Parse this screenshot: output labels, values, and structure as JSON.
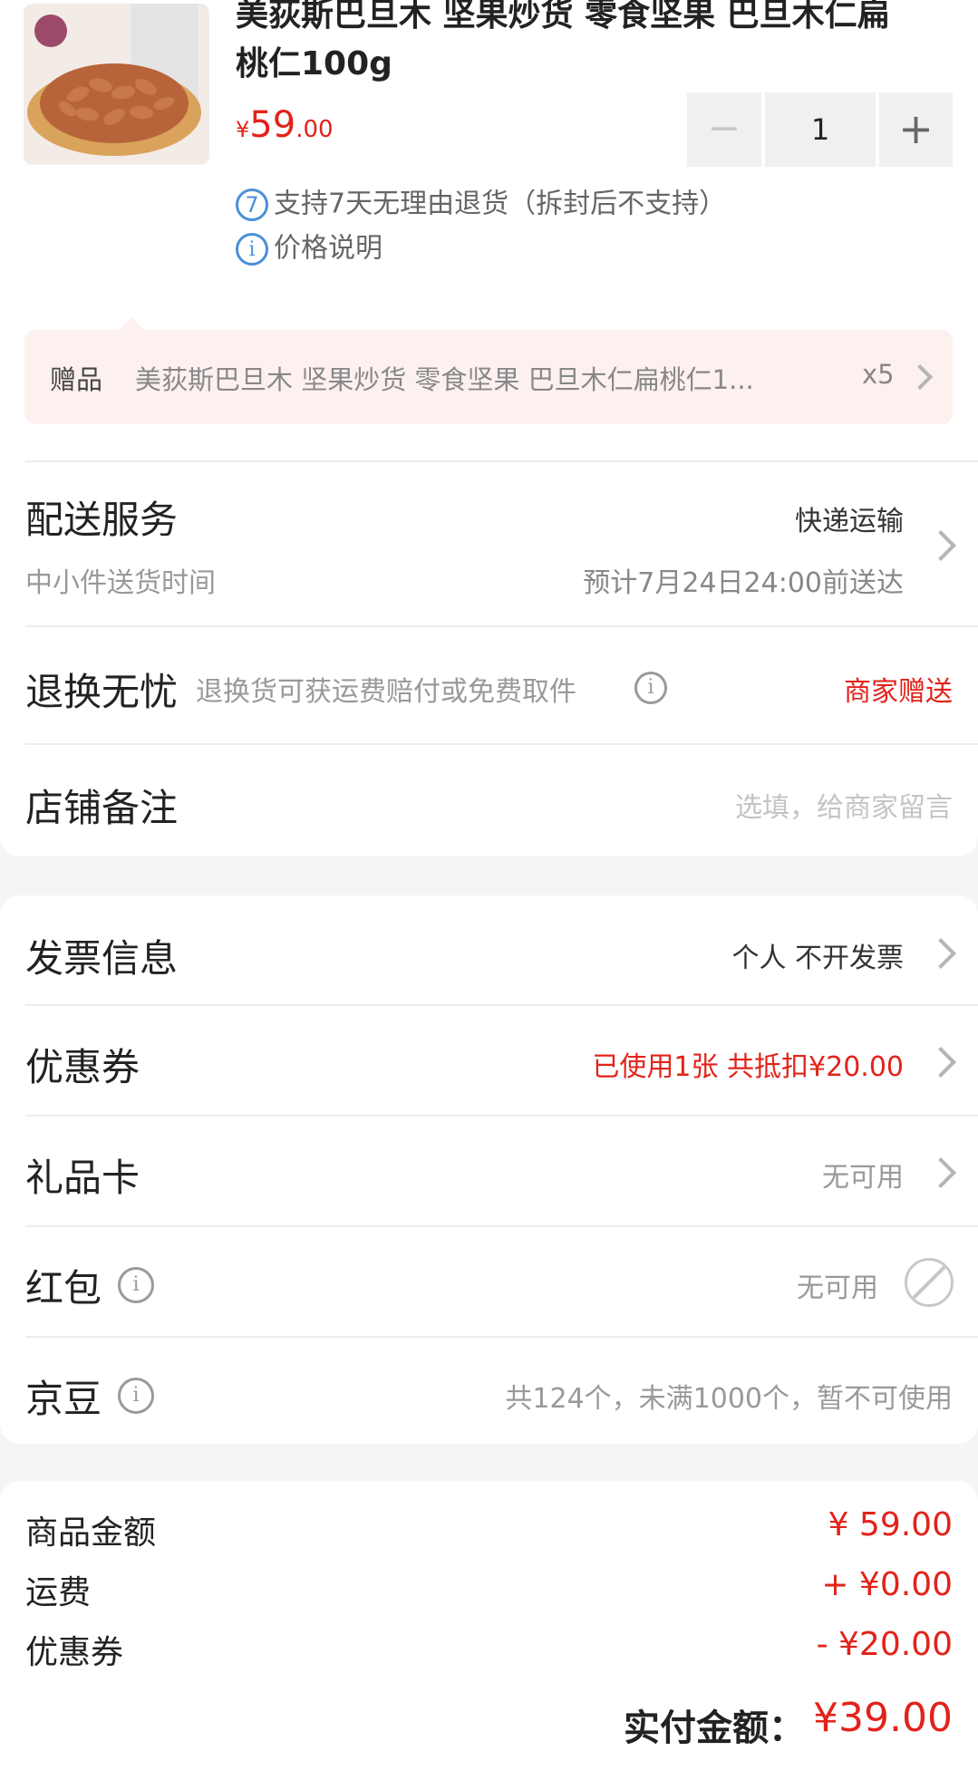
{
  "product": {
    "title_line1": "美荻斯巴旦木 坚果炒货 零食坚果 巴旦木仁扁",
    "title_line2": "桃仁100g",
    "currency": "¥",
    "price_int": "59",
    "price_dec": ".00",
    "qty": "1",
    "minus": "−",
    "plus": "+",
    "badge_7": "7",
    "return_policy": "支持7天无理由退货（拆封后不支持）",
    "price_note": "价格说明",
    "info_glyph": "i"
  },
  "gift": {
    "label": "赠品",
    "name": "美荻斯巴旦木 坚果炒货 零食坚果 巴旦木仁扁桃仁1...",
    "count": "x5"
  },
  "delivery": {
    "title": "配送服务",
    "method": "快递运输",
    "subtitle": "中小件送货时间",
    "eta": "预计7月24日24:00前送达"
  },
  "return_service": {
    "title": "退换无忧",
    "desc": "退换货可获运费赔付或免费取件",
    "status": "商家赠送"
  },
  "note": {
    "title": "店铺备注",
    "placeholder": "选填，给商家留言"
  },
  "invoice": {
    "title": "发票信息",
    "value": "个人 不开发票"
  },
  "coupon": {
    "title": "优惠券",
    "value": "已使用1张 共抵扣¥20.00"
  },
  "giftcard": {
    "title": "礼品卡",
    "value": "无可用"
  },
  "redpacket": {
    "title": "红包",
    "value": "无可用"
  },
  "jingdou": {
    "title": "京豆",
    "value": "共124个，未满1000个，暂不可使用"
  },
  "summary": {
    "goods_label": "商品金额",
    "goods_value": "¥ 59.00",
    "shipping_label": "运费",
    "shipping_value": "+ ¥0.00",
    "coupon_label": "优惠券",
    "coupon_value": "- ¥20.00",
    "total_label": "实付金额：",
    "total_value": "¥39.00"
  },
  "colors": {
    "accent": "#e2231a",
    "blue": "#4a90d9",
    "gift_bg": "#fdf1f0"
  }
}
